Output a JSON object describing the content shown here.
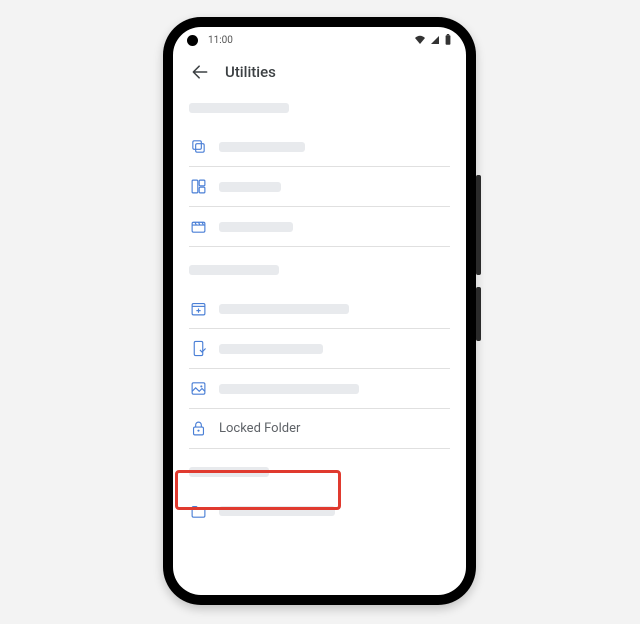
{
  "statusbar": {
    "time": "11:00"
  },
  "header": {
    "title": "Utilities"
  },
  "sections": [
    {
      "id": "group-1",
      "items": [
        {
          "id": "free-up-space",
          "icon": "copy-stack-icon"
        },
        {
          "id": "collage-maker",
          "icon": "dashboard-icon"
        },
        {
          "id": "movie-maker",
          "icon": "clapper-icon"
        }
      ]
    },
    {
      "id": "group-2",
      "items": [
        {
          "id": "import-photos",
          "icon": "add-photo-icon"
        },
        {
          "id": "photo-scan",
          "icon": "phone-check-icon"
        },
        {
          "id": "gallery",
          "icon": "image-icon"
        },
        {
          "id": "locked-folder",
          "icon": "lock-icon",
          "label": "Locked Folder",
          "highlighted": true
        }
      ]
    },
    {
      "id": "group-3",
      "items": [
        {
          "id": "browse-folders",
          "icon": "folder-icon"
        }
      ]
    }
  ],
  "colors": {
    "accent": "#4a7fd6",
    "callout": "#e03a2f",
    "skeleton": "#e8eaed"
  }
}
